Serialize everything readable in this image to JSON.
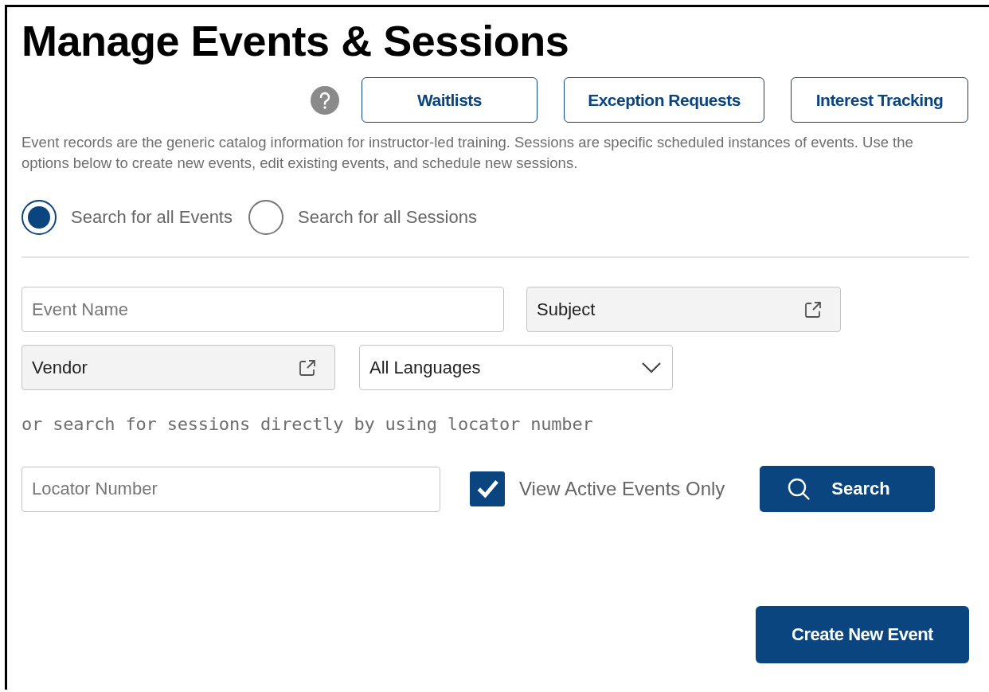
{
  "title": "Manage Events & Sessions",
  "header_buttons": [
    "Waitlists",
    "Exception Requests",
    "Interest Tracking"
  ],
  "description": "Event records are the generic catalog information for instructor-led training. Sessions are specific scheduled instances of events. Use the options below to create new events, edit existing events, and schedule new sessions.",
  "search_mode": [
    {
      "label": "Search for all Events",
      "selected": true
    },
    {
      "label": "Search for all Sessions",
      "selected": false
    }
  ],
  "field_rows": [
    [
      {
        "kind": "text",
        "placeholder": "Event Name"
      },
      {
        "kind": "lookup",
        "value": "Subject"
      }
    ],
    [
      {
        "kind": "lookup",
        "value": "Vendor"
      },
      {
        "kind": "select",
        "value": "All Languages"
      }
    ]
  ],
  "locator_hint": "or search for sessions directly by using locator number",
  "locator_field": {
    "placeholder": "Locator Number"
  },
  "active_only": {
    "label": "View Active Events Only",
    "checked": true
  },
  "search_button": "Search",
  "create_button": "Create New Event"
}
